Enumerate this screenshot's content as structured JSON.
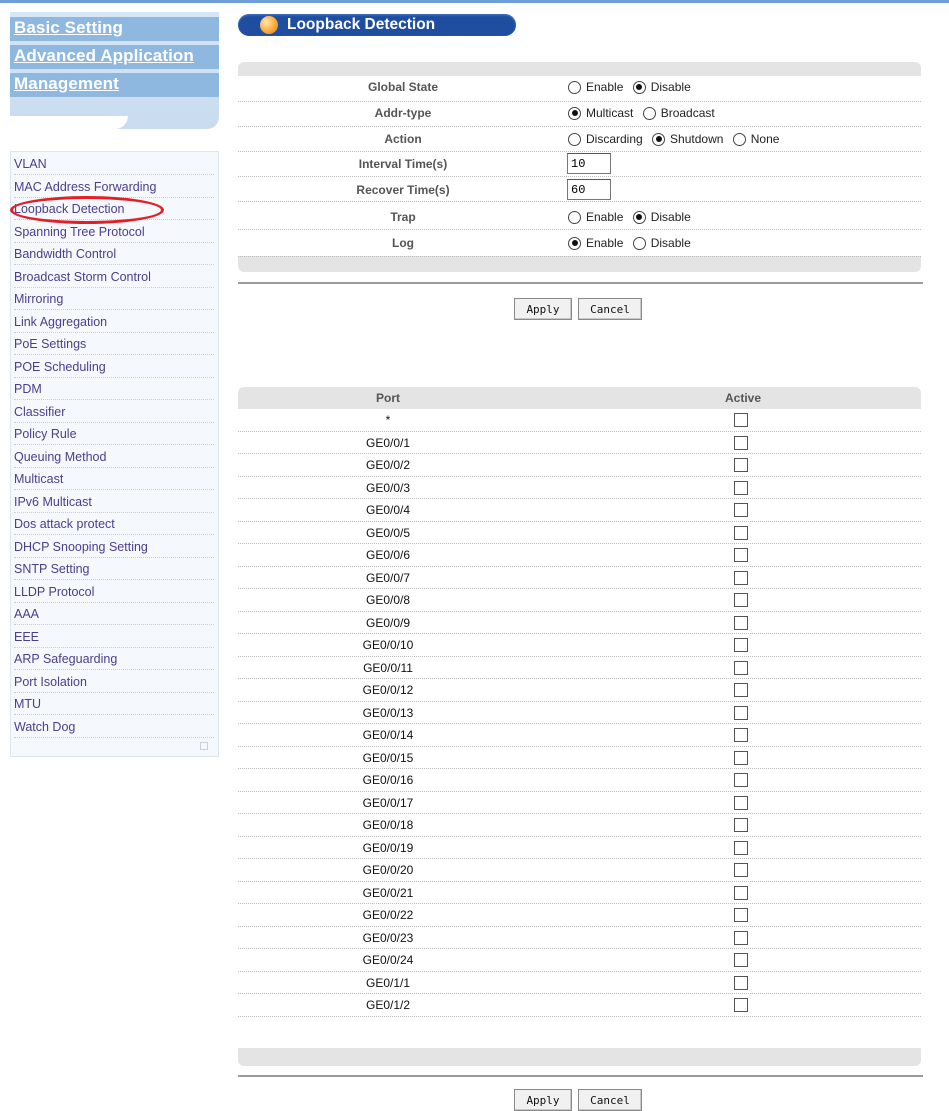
{
  "nav": {
    "main_links": [
      "Basic Setting",
      "Advanced Application",
      "Management"
    ],
    "items": [
      "VLAN",
      "MAC Address Forwarding",
      "Loopback Detection",
      "Spanning Tree Protocol",
      "Bandwidth Control",
      "Broadcast Storm Control",
      "Mirroring",
      "Link Aggregation",
      "PoE Settings",
      "POE Scheduling",
      "PDM",
      "Classifier",
      "Policy Rule",
      "Queuing Method",
      "Multicast",
      "IPv6 Multicast",
      "Dos attack protect",
      "DHCP Snooping Setting",
      "SNTP Setting",
      "LLDP Protocol",
      "AAA",
      "EEE",
      "ARP Safeguarding",
      "Port Isolation",
      "MTU",
      "Watch Dog"
    ],
    "highlighted_item": "Loopback Detection"
  },
  "page_title": "Loopback Detection",
  "settings": {
    "global_state": {
      "label": "Global State",
      "options": [
        "Enable",
        "Disable"
      ],
      "selected": "Disable"
    },
    "addr_type": {
      "label": "Addr-type",
      "options": [
        "Multicast",
        "Broadcast"
      ],
      "selected": "Multicast"
    },
    "action": {
      "label": "Action",
      "options": [
        "Discarding",
        "Shutdown",
        "None"
      ],
      "selected": "Shutdown"
    },
    "interval_time": {
      "label": "Interval Time(s)",
      "value": "10"
    },
    "recover_time": {
      "label": "Recover Time(s)",
      "value": "60"
    },
    "trap": {
      "label": "Trap",
      "options": [
        "Enable",
        "Disable"
      ],
      "selected": "Disable"
    },
    "log": {
      "label": "Log",
      "options": [
        "Enable",
        "Disable"
      ],
      "selected": "Enable"
    }
  },
  "buttons": {
    "apply": "Apply",
    "cancel": "Cancel"
  },
  "port_table": {
    "headers": {
      "port": "Port",
      "active": "Active"
    },
    "rows": [
      {
        "port": "*",
        "active": false
      },
      {
        "port": "GE0/0/1",
        "active": false
      },
      {
        "port": "GE0/0/2",
        "active": false
      },
      {
        "port": "GE0/0/3",
        "active": false
      },
      {
        "port": "GE0/0/4",
        "active": false
      },
      {
        "port": "GE0/0/5",
        "active": false
      },
      {
        "port": "GE0/0/6",
        "active": false
      },
      {
        "port": "GE0/0/7",
        "active": false
      },
      {
        "port": "GE0/0/8",
        "active": false
      },
      {
        "port": "GE0/0/9",
        "active": false
      },
      {
        "port": "GE0/0/10",
        "active": false
      },
      {
        "port": "GE0/0/11",
        "active": false
      },
      {
        "port": "GE0/0/12",
        "active": false
      },
      {
        "port": "GE0/0/13",
        "active": false
      },
      {
        "port": "GE0/0/14",
        "active": false
      },
      {
        "port": "GE0/0/15",
        "active": false
      },
      {
        "port": "GE0/0/16",
        "active": false
      },
      {
        "port": "GE0/0/17",
        "active": false
      },
      {
        "port": "GE0/0/18",
        "active": false
      },
      {
        "port": "GE0/0/19",
        "active": false
      },
      {
        "port": "GE0/0/20",
        "active": false
      },
      {
        "port": "GE0/0/21",
        "active": false
      },
      {
        "port": "GE0/0/22",
        "active": false
      },
      {
        "port": "GE0/0/23",
        "active": false
      },
      {
        "port": "GE0/0/24",
        "active": false
      },
      {
        "port": "GE0/1/1",
        "active": false
      },
      {
        "port": "GE0/1/2",
        "active": false
      }
    ]
  },
  "colors": {
    "title_bar": "#1f4ea0",
    "nav_link": "#4b3e8c",
    "highlight": "#e31f26"
  }
}
